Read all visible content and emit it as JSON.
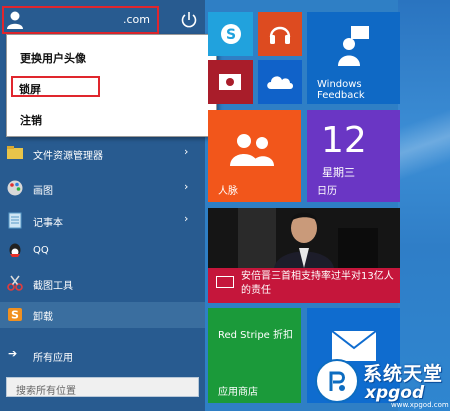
{
  "user": {
    "name_suffix": ".com"
  },
  "popup": {
    "items": [
      "更换用户头像",
      "锁屏",
      "注销"
    ]
  },
  "menu": {
    "items": [
      {
        "label": "文件资源管理器",
        "has_arrow": true,
        "icon": "folder-icon"
      },
      {
        "label": "画图",
        "has_arrow": true,
        "icon": "paint-icon"
      },
      {
        "label": "记事本",
        "has_arrow": true,
        "icon": "notepad-icon"
      },
      {
        "label": "QQ",
        "has_arrow": false,
        "icon": "qq-icon"
      },
      {
        "label": "截图工具",
        "has_arrow": false,
        "icon": "scissors-icon"
      },
      {
        "label": "卸载",
        "has_arrow": false,
        "icon": "uninstall-icon"
      }
    ],
    "all_apps": "所有应用"
  },
  "search": {
    "placeholder": "搜索所有位置"
  },
  "tiles": {
    "feedback": "Windows\nFeedback",
    "people": "人脉",
    "calendar": {
      "day_number": "12",
      "weekday": "星期三",
      "label": "日历"
    },
    "news": {
      "caption": "安倍晋三首相支持率过半对13亿人的责任"
    },
    "store": {
      "title": "Red Stripe 折扣",
      "label": "应用商店"
    }
  },
  "watermark": {
    "text1": "系统天堂",
    "text2": "xpgod",
    "url": "www.xpgod.com"
  },
  "colors": {
    "start_bg": "#285b90",
    "highlight_red": "#e0262d",
    "skype": "#21a2dd",
    "music": "#dd4b20",
    "video": "#a91d2a",
    "onedrive": "#1062c9",
    "feedback": "#0f69c5",
    "people": "#f2561b",
    "calendar": "#6a36c4",
    "news": "#c5163b",
    "store": "#1b9a3a",
    "mail": "#0f6ccf"
  }
}
